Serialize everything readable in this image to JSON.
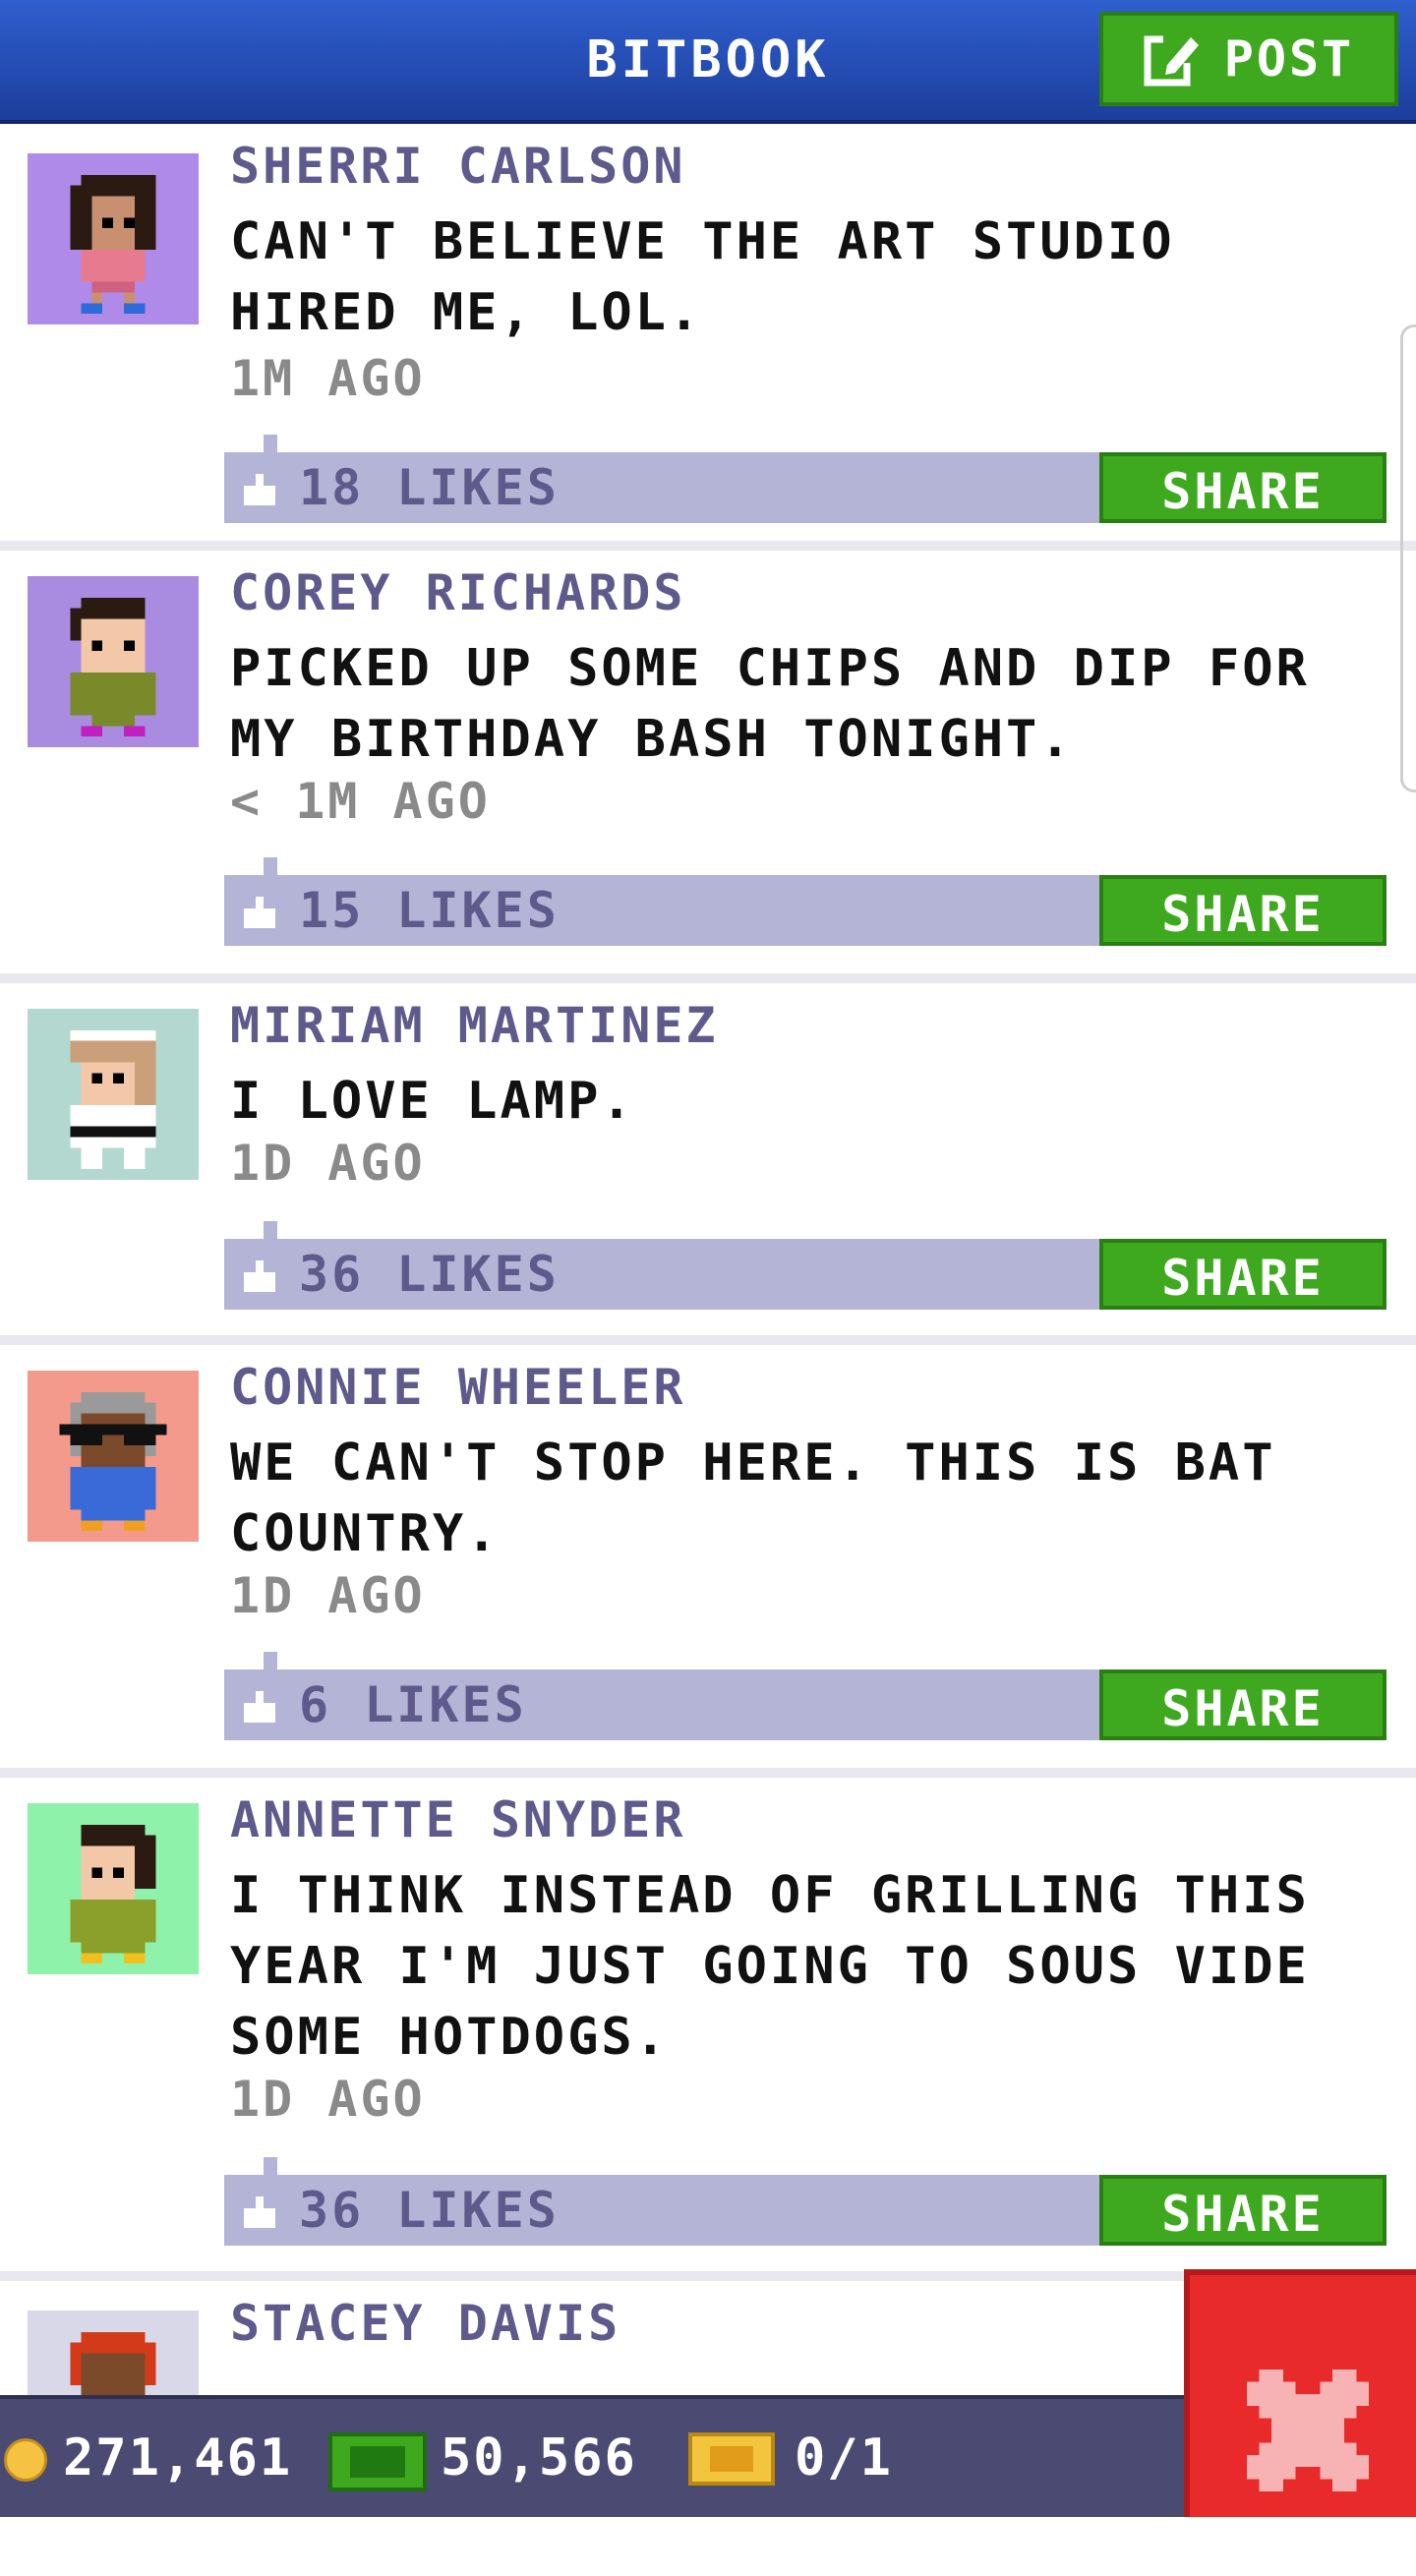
{
  "header": {
    "title": "BITBOOK",
    "post_label": "POST"
  },
  "posts": [
    {
      "name": "SHERRI CARLSON",
      "text": "CAN'T BELIEVE THE ART STUDIO HIRED ME, LOL.",
      "time": "1M AGO",
      "likes": "18 LIKES",
      "share_label": "SHARE",
      "avatar_bg": "#b08ae8"
    },
    {
      "name": "COREY RICHARDS",
      "text": "PICKED UP SOME CHIPS AND DIP FOR MY BIRTHDAY BASH TONIGHT.",
      "time": "< 1M AGO",
      "likes": "15 LIKES",
      "share_label": "SHARE",
      "avatar_bg": "#a98be0"
    },
    {
      "name": "MIRIAM MARTINEZ",
      "text": "I LOVE LAMP.",
      "time": "1D AGO",
      "likes": "36 LIKES",
      "share_label": "SHARE",
      "avatar_bg": "#b2d8cf"
    },
    {
      "name": "CONNIE WHEELER",
      "text": "WE CAN'T STOP HERE. THIS IS BAT COUNTRY.",
      "time": "1D AGO",
      "likes": "6 LIKES",
      "share_label": "SHARE",
      "avatar_bg": "#f49a8c"
    },
    {
      "name": "ANNETTE SNYDER",
      "text": "I THINK INSTEAD OF GRILLING THIS YEAR I'M JUST GOING TO SOUS VIDE SOME HOTDOGS.",
      "time": "1D AGO",
      "likes": "36 LIKES",
      "share_label": "SHARE",
      "avatar_bg": "#8ef2aa"
    },
    {
      "name": "STACEY DAVIS",
      "avatar_bg": "#d8d8e8"
    }
  ],
  "status_bar": {
    "coins": "271,461",
    "cash": "50,566",
    "tickets": "0/1"
  },
  "colors": {
    "header": "#2448b4",
    "accent_green": "#3ea91f",
    "like_bar": "#b4b5d6",
    "name_text": "#5e5a8c",
    "close_red": "#e82a2a",
    "bottom_bar": "#4a4a72"
  },
  "icons": {
    "post": "compose-icon",
    "like": "thumbs-up-icon",
    "coin": "coin-icon",
    "cash": "cash-icon",
    "ticket": "ticket-icon",
    "close": "close-icon"
  }
}
